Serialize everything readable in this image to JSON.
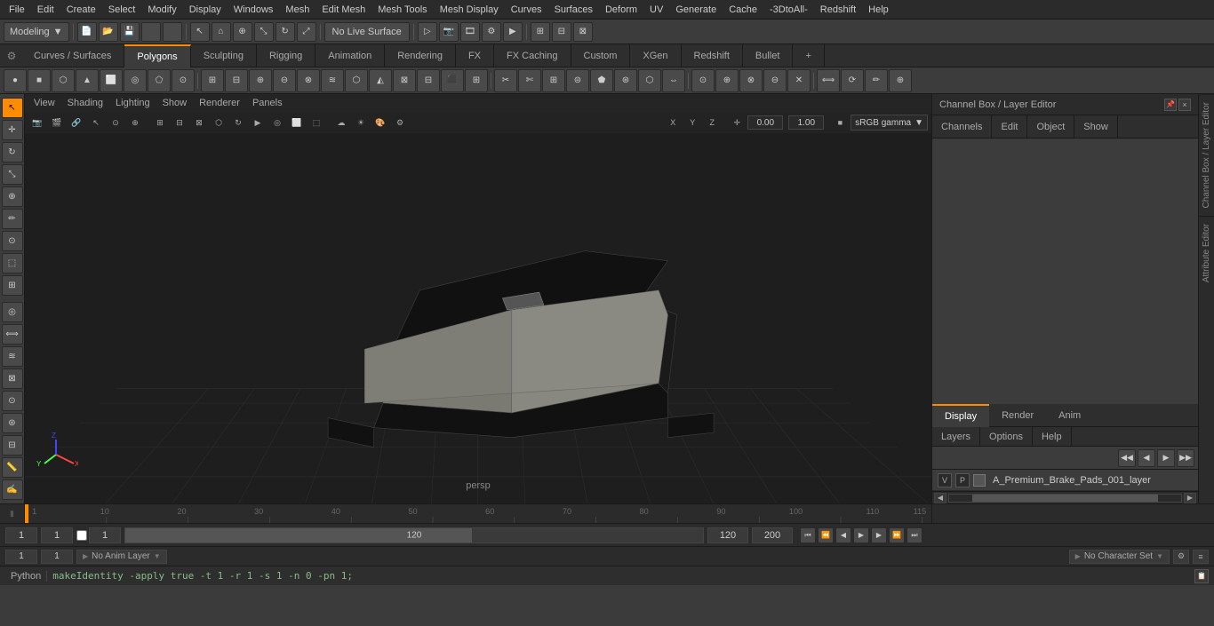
{
  "menubar": {
    "items": [
      "File",
      "Edit",
      "Create",
      "Select",
      "Modify",
      "Display",
      "Windows",
      "Mesh",
      "Edit Mesh",
      "Mesh Tools",
      "Mesh Display",
      "Curves",
      "Surfaces",
      "Deform",
      "UV",
      "Generate",
      "Cache",
      "-3DtoAll-",
      "Redshift",
      "Help"
    ]
  },
  "toolbar": {
    "mode_dropdown": "Modeling",
    "live_surface": "No Live Surface",
    "camera_btn": "▷",
    "undo_icon": "↩",
    "redo_icon": "↪"
  },
  "tabs": {
    "items": [
      "Curves / Surfaces",
      "Polygons",
      "Sculpting",
      "Rigging",
      "Animation",
      "Rendering",
      "FX",
      "FX Caching",
      "Custom",
      "XGen",
      "Redshift",
      "Bullet"
    ]
  },
  "viewport": {
    "menu": [
      "View",
      "Shading",
      "Lighting",
      "Show",
      "Renderer",
      "Panels"
    ],
    "label": "persp",
    "overlay_values": {
      "value1": "0.00",
      "value2": "1.00",
      "gamma": "sRGB gamma"
    }
  },
  "right_panel": {
    "title": "Channel Box / Layer Editor",
    "menu_items": [
      "Channels",
      "Edit",
      "Object",
      "Show"
    ],
    "display_tabs": [
      "Display",
      "Render",
      "Anim"
    ],
    "active_display_tab": "Display",
    "layers_menu": [
      "Layers",
      "Options",
      "Help"
    ],
    "layer_item": {
      "name": "A_Premium_Brake_Pads_001_layer",
      "v": "V",
      "p": "P"
    }
  },
  "status_bar": {
    "frame_start": "1",
    "frame_current": "1",
    "frame_checkbox": "1",
    "frame_end_slider": "120",
    "frame_end": "120",
    "frame_total": "200"
  },
  "bottom_bar": {
    "input1": "1",
    "input2": "1",
    "anim_layer": "No Anim Layer",
    "char_set": "No Character Set"
  },
  "python_bar": {
    "label": "Python",
    "command": "makeIdentity -apply true -t 1 -r 1 -s 1 -n 0 -pn 1;"
  },
  "vtabs": [
    "Channel Box / Layer Editor",
    "Attribute Editor"
  ],
  "icons": {
    "gear": "⚙",
    "arrow_left": "◀",
    "arrow_right": "▶",
    "arrow_up": "▲",
    "arrow_down": "▼",
    "plus": "+",
    "minus": "-",
    "close": "×",
    "check": "✓",
    "circle": "●",
    "square": "■",
    "triangle": "▲",
    "cursor": "↖",
    "move": "✛",
    "rotate": "↻",
    "scale": "⤡",
    "select_region": "⬚",
    "lasso": "⌘",
    "brush": "✏",
    "magnet": "⊕",
    "pivot": "⊙",
    "snap": "⊞",
    "grid": "⊟",
    "playback_start": "⏮",
    "playback_prev": "⏪",
    "playback_prevframe": "◀",
    "playback_play": "▶",
    "playback_nextframe": "▶",
    "playback_next": "⏩",
    "playback_end": "⏭"
  },
  "layers_label": "Layers"
}
